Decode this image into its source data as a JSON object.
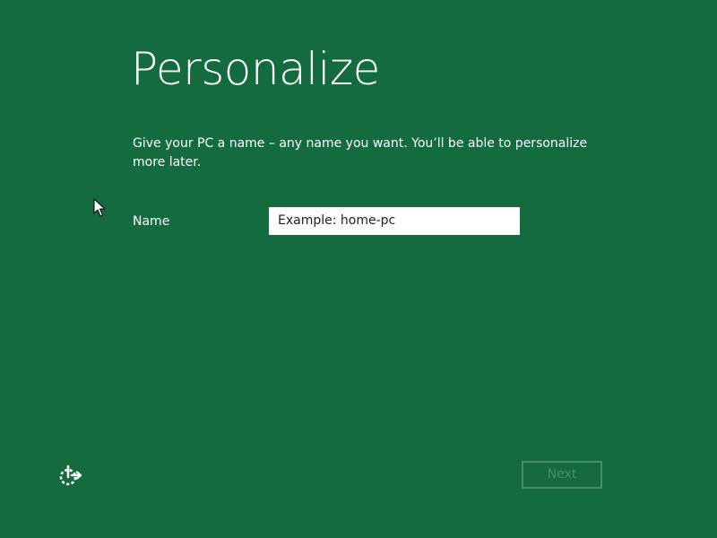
{
  "page": {
    "title": "Personalize",
    "description": "Give your PC a name – any name you want. You’ll be able to personalize more later."
  },
  "form": {
    "name_label": "Name",
    "name_value": "",
    "name_placeholder": "Example: home-pc"
  },
  "footer": {
    "next_label": "Next",
    "next_enabled": false,
    "ease_of_access_icon": "ease-of-access-icon"
  },
  "colors": {
    "background": "#146c3e",
    "text": "#ffffff",
    "disabled_button": "#4a8d64"
  }
}
